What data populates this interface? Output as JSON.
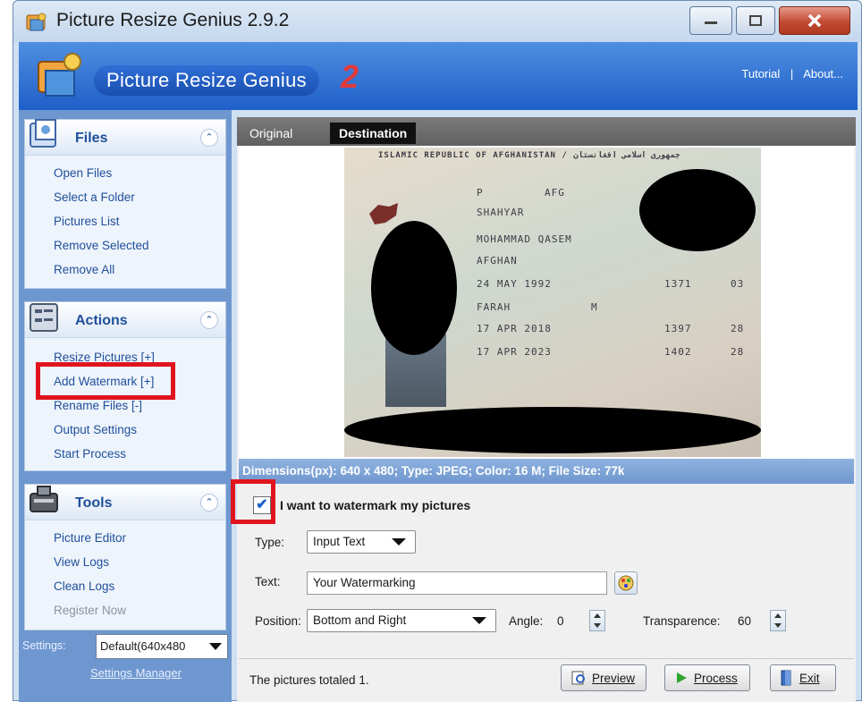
{
  "window": {
    "title": "Picture Resize Genius 2.9.2"
  },
  "banner": {
    "name": "Picture Resize Genius",
    "version": "2",
    "link_tutorial": "Tutorial",
    "link_sep": "|",
    "link_about": "About..."
  },
  "sidebar": {
    "files": {
      "title": "Files",
      "items": [
        "Open Files",
        "Select a Folder",
        "Pictures List",
        "Remove Selected",
        "Remove All"
      ]
    },
    "actions": {
      "title": "Actions",
      "items": [
        "Resize Pictures [+]",
        "Add Watermark [+]",
        "Rename Files [-]",
        "Output Settings",
        "Start Process"
      ]
    },
    "tools": {
      "title": "Tools",
      "items": [
        "Picture Editor",
        "View Logs",
        "Clean Logs",
        "Register Now"
      ]
    },
    "settings": {
      "label": "Settings:",
      "selected": "Default(640x480",
      "manager_link": "Settings Manager"
    }
  },
  "tabs": {
    "original": "Original",
    "destination": "Destination"
  },
  "preview": {
    "passport_lines": [
      "ISLAMIC REPUBLIC OF AFGHANISTAN / جمهوری اسلامی افغانستان",
      "P",
      "AFG",
      "SHAHYAR",
      "MOHAMMAD QASEM",
      "AFGHAN",
      "24 MAY 1992",
      "FARAH",
      "M",
      "17 APR 2018",
      "17 APR 2023",
      "1371",
      "03",
      "1397",
      "28",
      "1402",
      "28"
    ],
    "dimensions": "Dimensions(px): 640 x 480; Type: JPEG; Color: 16 M; File Size: 77k"
  },
  "watermark": {
    "checkbox_label": "I want to watermark my pictures",
    "checked": true,
    "type_label": "Type:",
    "type_value": "Input Text",
    "text_label": "Text:",
    "text_value": "Your Watermarking",
    "position_label": "Position:",
    "position_value": "Bottom and Right",
    "angle_label": "Angle:",
    "angle_value": "0",
    "transparence_label": "Transparence:",
    "transparence_value": "60"
  },
  "footer": {
    "status": "The pictures totaled 1.",
    "preview_label": "Preview",
    "process_label": "Process",
    "exit_label": "Exit"
  },
  "colors": {
    "highlight_box": "#e0141e",
    "banner_blue": "#1f5fc9",
    "sidebar_blue": "#6f97cf"
  }
}
